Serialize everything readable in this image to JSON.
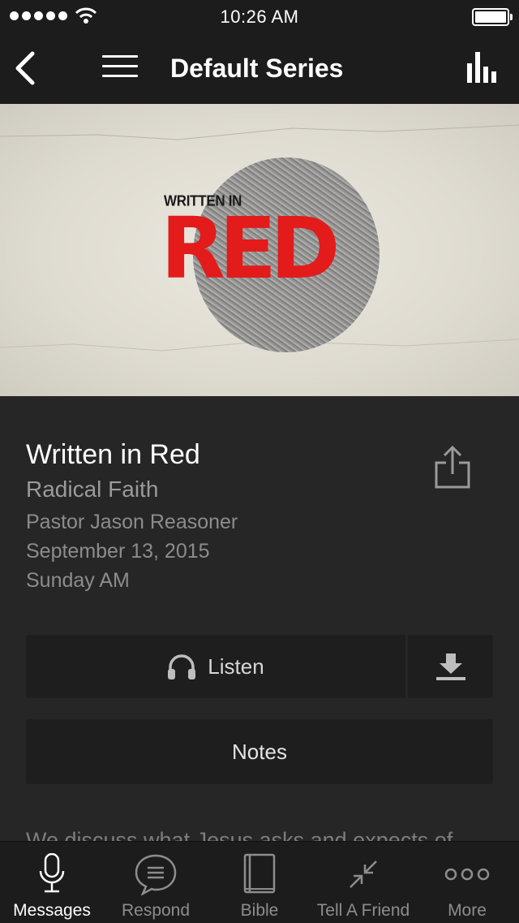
{
  "status_bar": {
    "time": "10:26 AM"
  },
  "nav": {
    "title": "Default Series"
  },
  "hero": {
    "small_text": "WRITTEN IN",
    "big_text": "RED"
  },
  "message": {
    "title": "Written in Red",
    "series": "Radical Faith",
    "speaker": "Pastor Jason Reasoner",
    "date": "September 13, 2015",
    "service": "Sunday AM",
    "description": "We discuss what Jesus asks and expects of"
  },
  "actions": {
    "listen_label": "Listen",
    "notes_label": "Notes"
  },
  "tabs": [
    {
      "label": "Messages",
      "icon": "microphone-icon",
      "active": true
    },
    {
      "label": "Respond",
      "icon": "speech-bubble-icon",
      "active": false
    },
    {
      "label": "Bible",
      "icon": "book-icon",
      "active": false
    },
    {
      "label": "Tell A Friend",
      "icon": "shrink-arrows-icon",
      "active": false
    },
    {
      "label": "More",
      "icon": "more-dots-icon",
      "active": false
    }
  ],
  "colors": {
    "accent_red": "#e31b1b",
    "background": "#262626",
    "bar": "#1c1c1c"
  }
}
